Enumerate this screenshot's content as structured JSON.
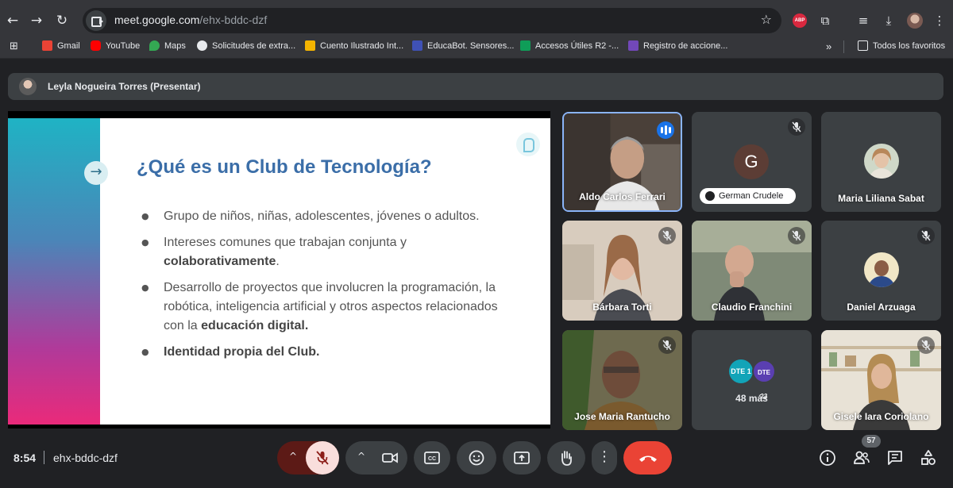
{
  "browser": {
    "url_host": "meet.google.com",
    "url_path": "/ehx-bddc-dzf"
  },
  "bookmarks": [
    {
      "label": "Gmail",
      "color": "#ea4335"
    },
    {
      "label": "YouTube",
      "color": "#ff0000"
    },
    {
      "label": "Maps",
      "color": "#34a853"
    },
    {
      "label": "Solicitudes de extra...",
      "color": "#e8eaed"
    },
    {
      "label": "Cuento Ilustrado Int...",
      "color": "#f4b400"
    },
    {
      "label": "EducaBot. Sensores...",
      "color": "#3f51b5"
    },
    {
      "label": "Accesos Útiles R2 -...",
      "color": "#0f9d58"
    },
    {
      "label": "Registro de accione...",
      "color": "#7248b9"
    }
  ],
  "bookmarks_all": "Todos los favoritos",
  "presenter": "Leyla Nogueira Torres (Presentar)",
  "slide": {
    "title": "¿Qué es un Club de Tecnología?",
    "b1": "Grupo de niños, niñas, adolescentes, jóvenes o adultos.",
    "b2_pre": "Intereses comunes que trabajan conjunta y ",
    "b2_bold": "colaborativamente",
    "b2_post": ".",
    "b3_pre": "Desarrollo de proyectos que involucren la programación, la robótica, inteligencia artificial y otros aspectos relacionados con la ",
    "b3_bold": "educación digital.",
    "b4_bold": "Identidad propia del Club."
  },
  "participants": {
    "p1": "Aldo Carlos Ferrari",
    "p2": "German Crudele",
    "p2_letter": "G",
    "p3": "Maria Liliana Sabat",
    "p4": "Bárbara Torti",
    "p5": "Claudio Franchini",
    "p6": "Daniel Arzuaga",
    "p7": "Jose Maria Rantucho",
    "more_badge1": "DTE 1",
    "more_badge2": "DTE 23",
    "more_label": "48 más",
    "p9": "Gisele Iara Coriolano"
  },
  "meeting": {
    "time": "8:54",
    "code": "ehx-bddc-dzf",
    "people_count": "57"
  },
  "colors": {
    "accent": "#8ab4f8",
    "end_call": "#ea4335",
    "mic_muted_bg": "#f9dedc",
    "slide_title": "#3b6ea8"
  }
}
